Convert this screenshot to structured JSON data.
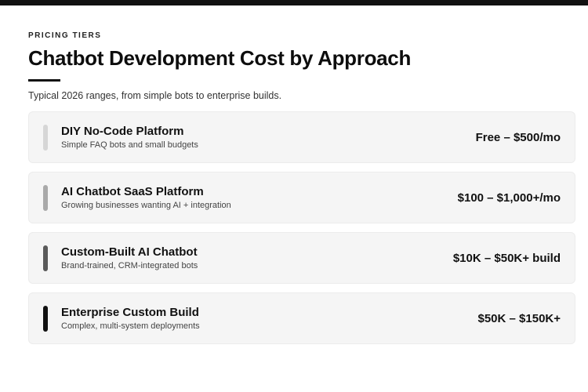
{
  "header": {
    "eyebrow": "PRICING TIERS",
    "title": "Chatbot Development Cost by Approach",
    "subtitle": "Typical 2026 ranges, from simple bots to enterprise builds."
  },
  "tiers": [
    {
      "name": "DIY No-Code Platform",
      "description": "Simple FAQ bots and small budgets",
      "price": "Free – $500/mo",
      "accent_color": "#d6d6d6"
    },
    {
      "name": "AI Chatbot SaaS Platform",
      "description": "Growing businesses wanting AI + integration",
      "price": "$100 – $1,000+/mo",
      "accent_color": "#a9a9a9"
    },
    {
      "name": "Custom-Built AI Chatbot",
      "description": "Brand-trained, CRM-integrated bots",
      "price": "$10K – $50K+ build",
      "accent_color": "#5a5a5a"
    },
    {
      "name": "Enterprise Custom Build",
      "description": "Complex, multi-system deployments",
      "price": "$50K – $150K+",
      "accent_color": "#111111"
    }
  ]
}
